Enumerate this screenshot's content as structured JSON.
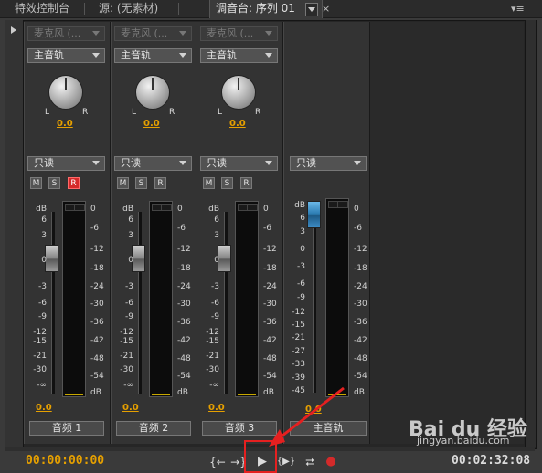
{
  "tabs": {
    "effect_controls": "特效控制台",
    "source": "源: (无素材)",
    "mixer": "调音台: 序列 01",
    "seq_short": "01",
    "close": "×",
    "menu": "▾≡"
  },
  "channels": [
    {
      "input": "麦克风 (...",
      "output": "主音轨",
      "pan_value": "0.0",
      "mode": "只读",
      "m": "M",
      "s": "S",
      "r": "R",
      "r_active": true,
      "fader_value": "0.0",
      "name": "音频 1"
    },
    {
      "input": "麦克风 (...",
      "output": "主音轨",
      "pan_value": "0.0",
      "mode": "只读",
      "m": "M",
      "s": "S",
      "r": "R",
      "r_active": false,
      "fader_value": "0.0",
      "name": "音频 2"
    },
    {
      "input": "麦克风 (...",
      "output": "主音轨",
      "pan_value": "0.0",
      "mode": "只读",
      "m": "M",
      "s": "S",
      "r": "R",
      "r_active": false,
      "fader_value": "0.0",
      "name": "音频 3"
    }
  ],
  "master": {
    "mode": "只读",
    "fader_value": "0.0",
    "name": "主音轨"
  },
  "pan_labels": {
    "left": "L",
    "right": "R"
  },
  "fader_scale": [
    "dB",
    "6",
    "3",
    "0",
    "-3",
    "-6",
    "-9",
    "-12",
    "-15",
    "-21",
    "-30",
    "-∞"
  ],
  "meter_scale": [
    "0",
    "-6",
    "-12",
    "-18",
    "-24",
    "-30",
    "-36",
    "-42",
    "-48",
    "-54",
    "dB"
  ],
  "master_fader_scale": [
    "dB",
    "6",
    "3",
    "0",
    "-3",
    "-6",
    "-9",
    "-12",
    "-15",
    "-21",
    "-27",
    "-33",
    "-39",
    "-45",
    "-∞"
  ],
  "transport": {
    "timecode_current": "00:00:00:00",
    "timecode_duration": "00:02:32:08",
    "btn_in": "{←",
    "btn_out": "→}",
    "btn_play": "▶",
    "btn_play_inout": "{▶}",
    "btn_loop": "⮂",
    "btn_record": "●"
  },
  "watermark": {
    "brand": "Bai du 经验",
    "url": "jingyan.baidu.com"
  },
  "colors": {
    "timecode": "#e6a000",
    "record_active": "#d42a2a",
    "highlight": "#e52020",
    "master_fader": "#2f7fb5"
  }
}
